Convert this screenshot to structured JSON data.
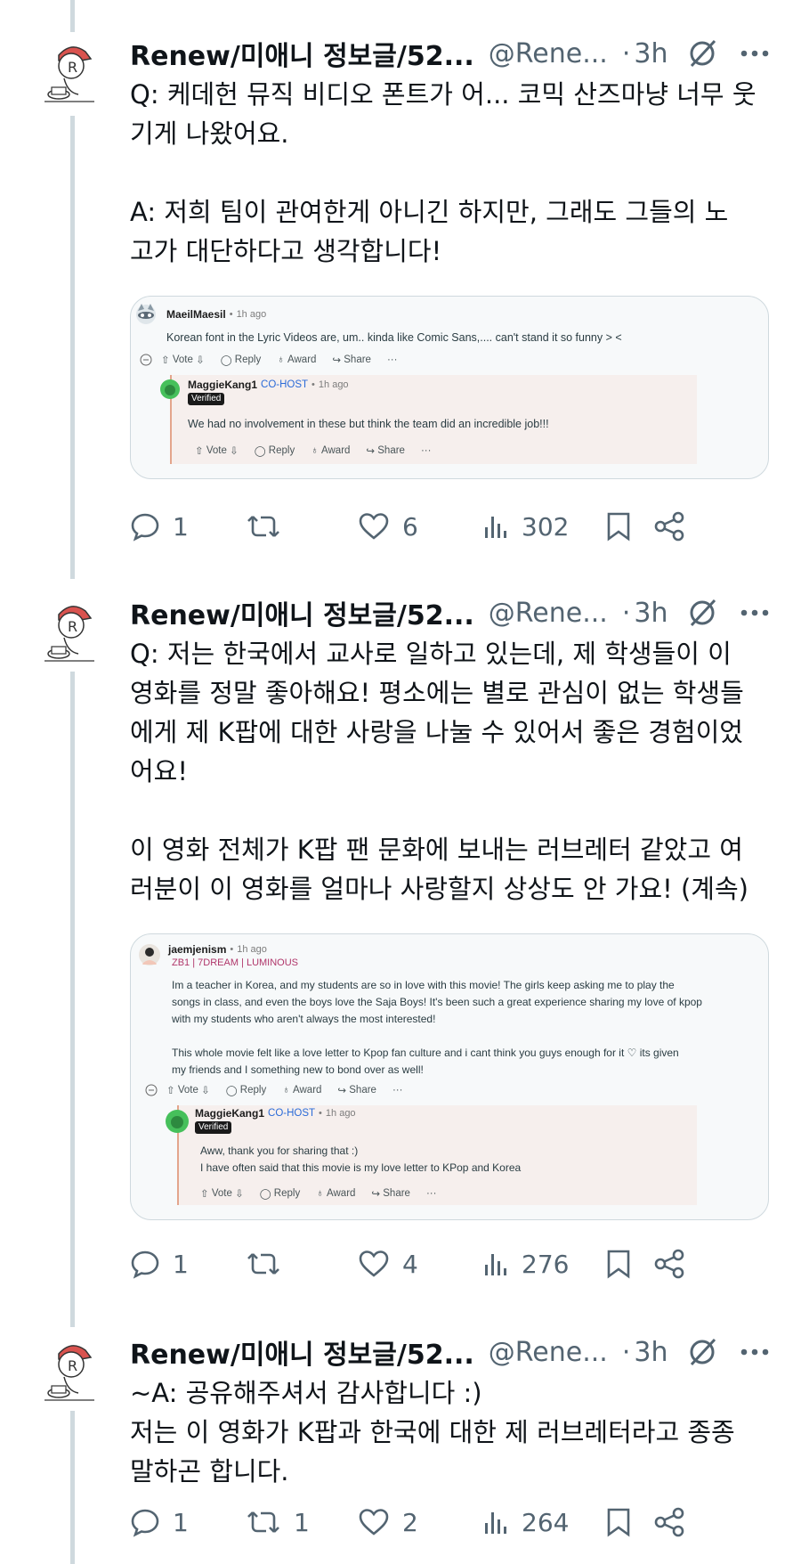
{
  "author": {
    "name": "Renew/미애니 정보글/52...",
    "handle": "@Rene...",
    "time": "3h"
  },
  "tweets": [
    {
      "text": "Q: 케데헌 뮤직 비디오 폰트가 어... 코믹 산즈마냥 너무 웃\n기게 나왔어요.\n\nA: 저희 팀이 관여한게 아니긴 하지만, 그래도 그들의 노\n고가 대단하다고 생각합니다!",
      "media": {
        "post_user": "MaeilMaesil",
        "post_time": "1h ago",
        "post_text": "Korean font in the Lyric Videos are, um.. kinda like Comic Sans,.... can't stand it so funny > <",
        "reply_user": "MaggieKang1",
        "reply_role": "CO-HOST",
        "reply_time": "1h ago",
        "verified": "Verified",
        "reply_text": "We had no involvement in these but think the team did an incredible job!!!"
      },
      "stats": {
        "replies": "1",
        "retweets": "",
        "likes": "6",
        "views": "302"
      }
    },
    {
      "text": "Q: 저는 한국에서 교사로 일하고 있는데, 제 학생들이 이\n영화를 정말 좋아해요! 평소에는 별로 관심이 없는 학생들\n에게 제 K팝에 대한 사랑을 나눌 수 있어서 좋은 경험이었\n어요!\n\n이 영화 전체가 K팝 팬 문화에 보내는 러브레터 같았고 여\n러분이 이 영화를 얼마나 사랑할지 상상도 안 가요! (계속)",
      "media": {
        "post_user": "jaemjenism",
        "post_time": "1h ago",
        "post_flair": "ZB1 | 7DREAM | LUMINOUS",
        "post_text": "Im a teacher in Korea, and my students are so in love with this movie! The girls keep asking me to play the\nsongs in class, and even the boys love the Saja Boys! It's been such a great experience sharing my love of kpop\nwith my students who aren't always the most interested!\n\nThis whole movie felt like a love letter to Kpop fan culture and i cant think you guys enough for it ♡ its given\nmy friends and I something new to bond over as well!",
        "reply_user": "MaggieKang1",
        "reply_role": "CO-HOST",
        "reply_time": "1h ago",
        "verified": "Verified",
        "reply_text": "Aww, thank you for sharing that :)\nI have often said that this movie is my love letter to KPop and Korea"
      },
      "stats": {
        "replies": "1",
        "retweets": "",
        "likes": "4",
        "views": "276"
      }
    },
    {
      "text": "~A: 공유해주셔서 감사합니다 :)\n저는 이 영화가 K팝과 한국에 대한 제 러브레터라고 종종\n말하곤 합니다.",
      "stats": {
        "replies": "1",
        "retweets": "1",
        "likes": "2",
        "views": "264"
      }
    }
  ],
  "reddit_actions": {
    "vote": "Vote",
    "reply": "Reply",
    "award": "Award",
    "share": "Share",
    "more": "···"
  },
  "colors": {
    "text": "#0f1419",
    "secondary": "#536471",
    "thread_line": "#cfd9de",
    "cohost": "#2b6bd8"
  }
}
